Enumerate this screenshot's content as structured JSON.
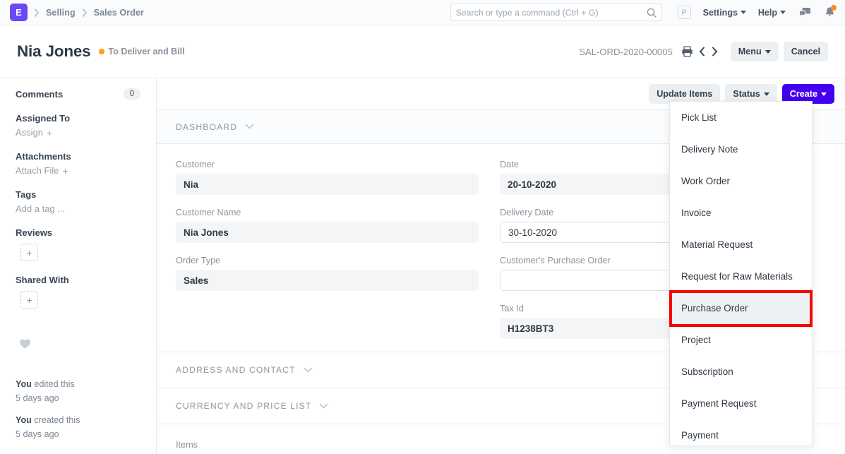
{
  "navbar": {
    "logo_letter": "E",
    "breadcrumbs": [
      "Selling",
      "Sales Order"
    ],
    "search": {
      "placeholder": "Search or type a command (Ctrl + G)",
      "value": ""
    },
    "avatar_letter": "P",
    "settings_label": "Settings",
    "help_label": "Help",
    "icons": [
      "search-icon",
      "chat-icon",
      "notifications-bell-icon"
    ],
    "notification_dot_color": "#ff8b24",
    "logo_color": "#6b47f5"
  },
  "pagehead": {
    "title": "Nia Jones",
    "status_text": "To Deliver and Bill",
    "status_color": "#ff9e0d",
    "doc_name": "SAL-ORD-2020-00005",
    "menu_label": "Menu",
    "cancel_label": "Cancel"
  },
  "sidebar": {
    "comments_label": "Comments",
    "comments_count": "0",
    "assigned_to_label": "Assigned To",
    "assign_label": "Assign",
    "attachments_label": "Attachments",
    "attach_file_label": "Attach File",
    "tags_label": "Tags",
    "add_tag_label": "Add a tag ...",
    "reviews_label": "Reviews",
    "shared_with_label": "Shared With",
    "plus_glyph": "+",
    "activity": [
      {
        "actor": "You",
        "action": " edited this",
        "time": "5 days ago"
      },
      {
        "actor": "You",
        "action": " created this",
        "time": "5 days ago"
      }
    ]
  },
  "toolbar": {
    "update_items_label": "Update Items",
    "status_label": "Status",
    "create_label": "Create",
    "create_color": "#4400ee"
  },
  "form": {
    "section_title": "DASHBOARD",
    "left_fields": [
      {
        "label": "Customer",
        "value": "Nia",
        "style": "filled"
      },
      {
        "label": "Customer Name",
        "value": "Nia Jones",
        "style": "filled"
      },
      {
        "label": "Order Type",
        "value": "Sales",
        "style": "filled"
      }
    ],
    "right_fields": [
      {
        "label": "Date",
        "value": "20-10-2020",
        "style": "filled"
      },
      {
        "label": "Delivery Date",
        "value": "30-10-2020",
        "style": "outline"
      },
      {
        "label": "Customer's Purchase Order",
        "value": "",
        "style": "outline"
      },
      {
        "label": "Tax Id",
        "value": "H1238BT3",
        "style": "filled"
      }
    ],
    "collapsed_sections": [
      "ADDRESS AND CONTACT",
      "CURRENCY AND PRICE LIST"
    ],
    "items_label": "Items"
  },
  "dropdown": {
    "items": [
      "Pick List",
      "Delivery Note",
      "Work Order",
      "Invoice",
      "Material Request",
      "Request for Raw Materials",
      "Purchase Order",
      "Project",
      "Subscription",
      "Payment Request",
      "Payment"
    ],
    "highlighted_item": "Purchase Order",
    "highlight_box_color": "#f60400"
  }
}
